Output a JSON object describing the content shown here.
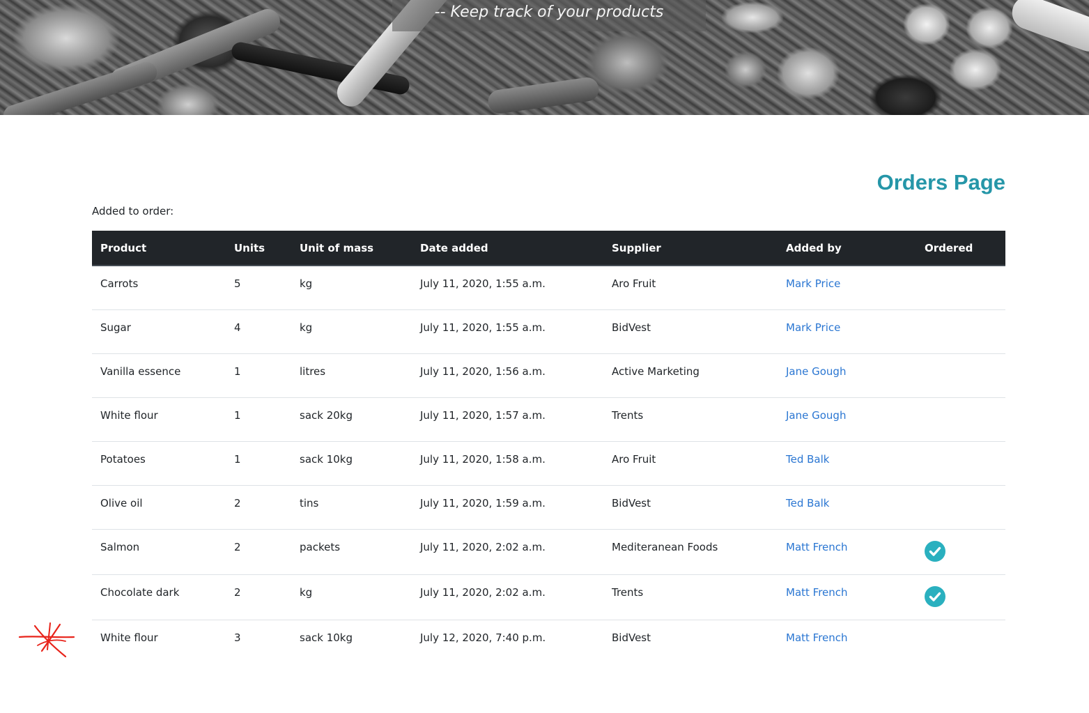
{
  "header": {
    "tagline": "-- Keep track of your products"
  },
  "main": {
    "title": "Orders Page",
    "intro": "Added to order:"
  },
  "table": {
    "columns": [
      "Product",
      "Units",
      "Unit of mass",
      "Date added",
      "Supplier",
      "Added by",
      "Ordered"
    ],
    "rows": [
      {
        "product": "Carrots",
        "units": "5",
        "unit_of_mass": "kg",
        "date_added": "July 11, 2020, 1:55 a.m.",
        "supplier": "Aro Fruit",
        "added_by": "Mark Price",
        "ordered": false
      },
      {
        "product": "Sugar",
        "units": "4",
        "unit_of_mass": "kg",
        "date_added": "July 11, 2020, 1:55 a.m.",
        "supplier": "BidVest",
        "added_by": "Mark Price",
        "ordered": false
      },
      {
        "product": "Vanilla essence",
        "units": "1",
        "unit_of_mass": "litres",
        "date_added": "July 11, 2020, 1:56 a.m.",
        "supplier": "Active Marketing",
        "added_by": "Jane Gough",
        "ordered": false
      },
      {
        "product": "White flour",
        "units": "1",
        "unit_of_mass": "sack 20kg",
        "date_added": "July 11, 2020, 1:57 a.m.",
        "supplier": "Trents",
        "added_by": "Jane Gough",
        "ordered": false
      },
      {
        "product": "Potatoes",
        "units": "1",
        "unit_of_mass": "sack 10kg",
        "date_added": "July 11, 2020, 1:58 a.m.",
        "supplier": "Aro Fruit",
        "added_by": "Ted Balk",
        "ordered": false
      },
      {
        "product": "Olive oil",
        "units": "2",
        "unit_of_mass": "tins",
        "date_added": "July 11, 2020, 1:59 a.m.",
        "supplier": "BidVest",
        "added_by": "Ted Balk",
        "ordered": false
      },
      {
        "product": "Salmon",
        "units": "2",
        "unit_of_mass": "packets",
        "date_added": "July 11, 2020, 2:02 a.m.",
        "supplier": "Mediteranean Foods",
        "added_by": "Matt French",
        "ordered": true
      },
      {
        "product": "Chocolate dark",
        "units": "2",
        "unit_of_mass": "kg",
        "date_added": "July 11, 2020, 2:02 a.m.",
        "supplier": "Trents",
        "added_by": "Matt French",
        "ordered": true
      },
      {
        "product": "White flour",
        "units": "3",
        "unit_of_mass": "sack 10kg",
        "date_added": "July 12, 2020, 7:40 p.m.",
        "supplier": "BidVest",
        "added_by": "Matt French",
        "ordered": false
      }
    ]
  },
  "icons": {
    "ordered": "check-circle-icon",
    "annotation": "red-asterisk-scribble"
  },
  "colors": {
    "title": "#2596a8",
    "link": "#2a76d2",
    "check": "#2ab0bf",
    "header_bg": "#212529",
    "annotation": "#e8231a"
  }
}
